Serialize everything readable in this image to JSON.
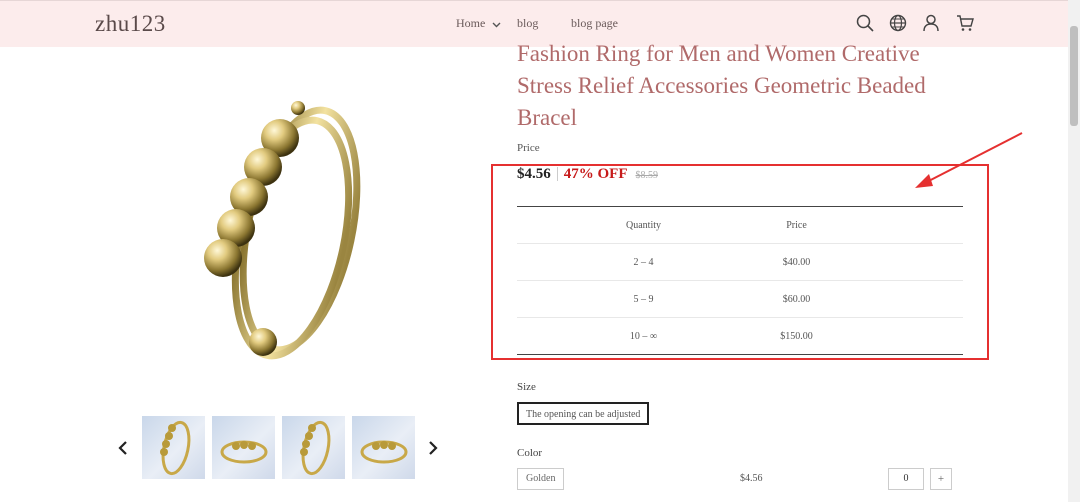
{
  "header": {
    "logo": "zhu123",
    "nav": [
      "Home",
      "blog",
      "blog page"
    ],
    "icons": [
      "search-icon",
      "globe-icon",
      "user-icon",
      "cart-icon"
    ],
    "background": "#fcecec"
  },
  "product": {
    "title": "Fashion Ring for Men and Women Creative Stress Relief Accessories Geometric Beaded Bracel",
    "price_label": "Price",
    "price_now": "$4.56",
    "discount": "47% OFF",
    "price_old": "$8.59"
  },
  "tier_table": {
    "headers": [
      "Quantity",
      "Price"
    ],
    "rows": [
      [
        "2 – 4",
        "$40.00"
      ],
      [
        "5 – 9",
        "$60.00"
      ],
      [
        "10 – ∞",
        "$150.00"
      ]
    ]
  },
  "size": {
    "label": "Size",
    "option": "The opening can be adjusted"
  },
  "color": {
    "label": "Color",
    "option": "Golden",
    "price": "$4.56",
    "quantity": "0",
    "plus": "+"
  },
  "gallery": {
    "thumb_count": 4
  },
  "colors": {
    "title": "#b06a6a",
    "discount": "#c71b1b",
    "highlight": "#e53030"
  }
}
